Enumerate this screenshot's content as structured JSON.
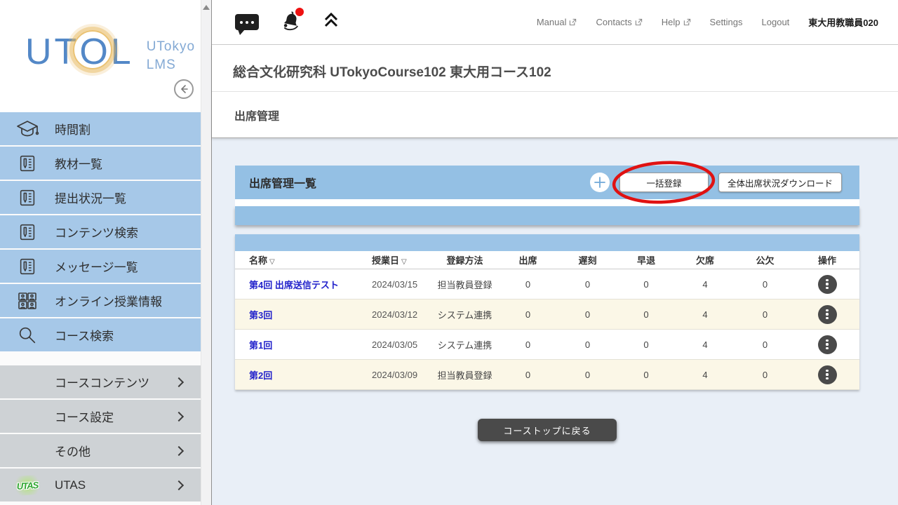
{
  "colors": {
    "sidebar_item_blue": "#a6c8e8",
    "sidebar_item_gray": "#ced2d5",
    "panel_header_blue": "#94c0e4",
    "table_bar_blue": "#9cc4e7",
    "content_bg": "#e9eff7",
    "row_cream": "#fbf7e7",
    "link_blue": "#2323cb",
    "annotation_red": "#e01212",
    "notification_red": "#ee1111"
  },
  "sidebar": {
    "logo_text": "UTOL",
    "logo_sub1": "UTokyo",
    "logo_sub2": "LMS",
    "utas_logo_text": "UTAS",
    "menu_items": [
      {
        "label": "時間割"
      },
      {
        "label": "教材一覧"
      },
      {
        "label": "提出状況一覧"
      },
      {
        "label": "コンテンツ検索"
      },
      {
        "label": "メッセージ一覧"
      },
      {
        "label": "オンライン授業情報"
      },
      {
        "label": "コース検索"
      }
    ],
    "section_items": [
      {
        "label": "コースコンテンツ"
      },
      {
        "label": "コース設定"
      },
      {
        "label": "その他"
      },
      {
        "label": "UTAS"
      }
    ]
  },
  "topnav": {
    "links": [
      {
        "label": "Manual"
      },
      {
        "label": "Contacts"
      },
      {
        "label": "Help"
      },
      {
        "label": "Settings"
      },
      {
        "label": "Logout"
      }
    ],
    "user_name": "東大用教職員020"
  },
  "page": {
    "course_title": "総合文化研究科 UTokyoCourse102 東大用コース102",
    "section_title": "出席管理"
  },
  "attendance_panel": {
    "title": "出席管理一覧",
    "bulk_register_label": "一括登録",
    "download_label": "全体出席状況ダウンロード"
  },
  "table": {
    "sort_glyph": "▽",
    "headers": [
      "名称",
      "授業日",
      "登録方法",
      "出席",
      "遅刻",
      "早退",
      "欠席",
      "公欠",
      "操作"
    ],
    "rows": [
      {
        "name": "第4回 出席送信テスト",
        "date": "2024/03/15",
        "method": "担当教員登録",
        "present": "0",
        "late": "0",
        "early_leave": "0",
        "absent": "4",
        "excused": "0"
      },
      {
        "name": "第3回",
        "date": "2024/03/12",
        "method": "システム連携",
        "present": "0",
        "late": "0",
        "early_leave": "0",
        "absent": "4",
        "excused": "0"
      },
      {
        "name": "第1回",
        "date": "2024/03/05",
        "method": "システム連携",
        "present": "0",
        "late": "0",
        "early_leave": "0",
        "absent": "4",
        "excused": "0"
      },
      {
        "name": "第2回",
        "date": "2024/03/09",
        "method": "担当教員登録",
        "present": "0",
        "late": "0",
        "early_leave": "0",
        "absent": "4",
        "excused": "0"
      }
    ]
  },
  "footer": {
    "back_button_label": "コーストップに戻る"
  }
}
